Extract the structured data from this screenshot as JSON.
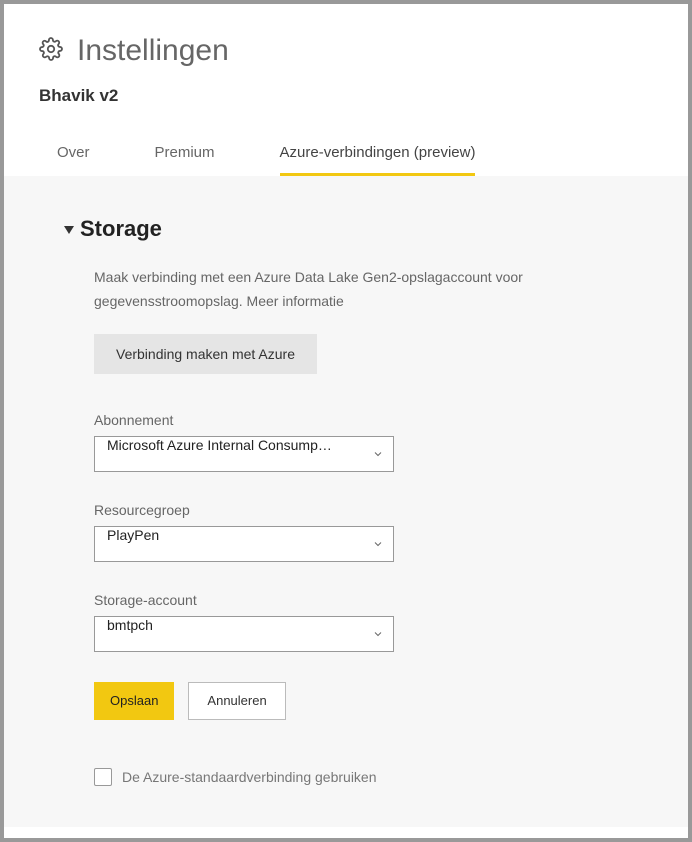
{
  "header": {
    "title": "Instellingen",
    "workspace": "Bhavik v2"
  },
  "tabs": {
    "over": "Over",
    "premium": "Premium",
    "azure": "Azure-verbindingen (preview)"
  },
  "section": {
    "title": "Storage",
    "description": "Maak verbinding met een Azure Data Lake Gen2-opslagaccount voor gegevensstroomopslag.",
    "more_info": "Meer informatie",
    "connect_button": "Verbinding maken met Azure"
  },
  "fields": {
    "subscription": {
      "label": "Abonnement",
      "value": "Microsoft Azure Internal Consump…"
    },
    "resource_group": {
      "label": "Resourcegroep",
      "value": "PlayPen"
    },
    "storage_account": {
      "label": "Storage-account",
      "value": "bmtpch"
    }
  },
  "buttons": {
    "save": "Opslaan",
    "cancel": "Annuleren"
  },
  "checkbox": {
    "default_connection": "De Azure-standaardverbinding gebruiken"
  }
}
